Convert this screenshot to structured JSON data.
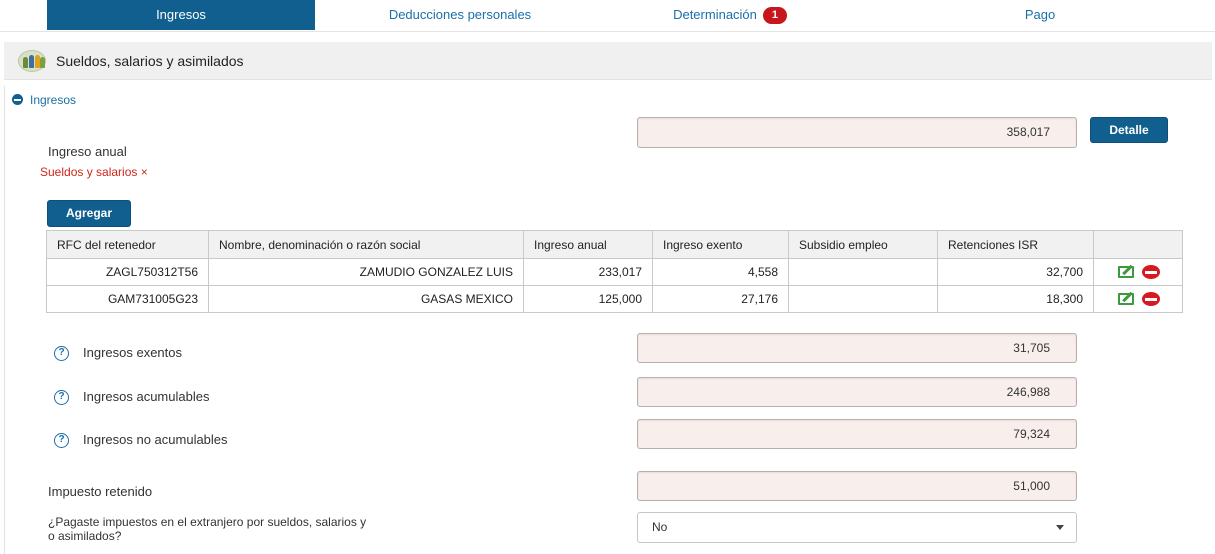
{
  "tabs": {
    "ingresos": "Ingresos",
    "deducciones": "Deducciones personales",
    "determinacion": "Determinación",
    "determinacion_badge": "1",
    "pago": "Pago"
  },
  "section": {
    "title": "Sueldos, salarios y asimilados",
    "icon": "people-group-icon"
  },
  "ingresos": {
    "toggle_label": "Ingresos",
    "ingreso_anual_label": "Ingreso anual",
    "ingreso_anual_value": "358,017",
    "detalle_button": "Detalle",
    "error_text": "Sueldos y salarios ×",
    "agregar_button": "Agregar"
  },
  "table": {
    "headers": [
      "RFC del retenedor",
      "Nombre, denominación o razón social",
      "Ingreso anual",
      "Ingreso exento",
      "Subsidio empleo",
      "Retenciones ISR",
      ""
    ],
    "rows": [
      {
        "rfc": "ZAGL750312T56",
        "nombre": "ZAMUDIO GONZALEZ LUIS",
        "ingreso_anual": "233,017",
        "ingreso_exento": "4,558",
        "subsidio": "",
        "retenciones": "32,700"
      },
      {
        "rfc": "GAM731005G23",
        "nombre": "GASAS MEXICO",
        "ingreso_anual": "125,000",
        "ingreso_exento": "27,176",
        "subsidio": "",
        "retenciones": "18,300"
      }
    ]
  },
  "totals": {
    "exentos_label": "Ingresos exentos",
    "exentos_value": "31,705",
    "acumulables_label": "Ingresos acumulables",
    "acumulables_value": "246,988",
    "no_acumulables_label": "Ingresos no acumulables",
    "no_acumulables_value": "79,324",
    "impuesto_label": "Impuesto retenido",
    "impuesto_value": "51,000"
  },
  "extranjero": {
    "question_line1": "¿Pagaste impuestos en el extranjero por sueldos, salarios y",
    "question_line2": "o asimilados?",
    "selected": "No"
  },
  "colors": {
    "primary": "#115f8e",
    "link": "#1a6fa8",
    "error": "#d0251c",
    "field_bg": "#f8efec"
  }
}
